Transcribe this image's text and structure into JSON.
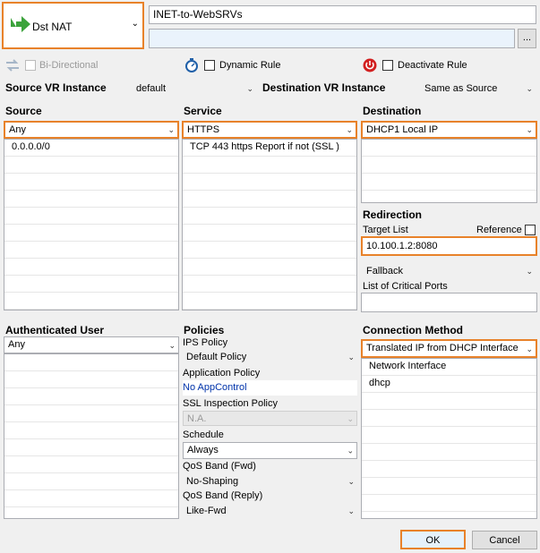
{
  "rule": {
    "action_label": "Dst NAT",
    "name": "INET-to-WebSRVs",
    "comment": "",
    "more_button": "..."
  },
  "options": {
    "bidirectional": "Bi-Directional",
    "dynamic_rule": "Dynamic Rule",
    "deactivate_rule": "Deactivate Rule"
  },
  "vr": {
    "source_label": "Source VR Instance",
    "source_value": "default",
    "dest_label": "Destination VR Instance",
    "dest_value": "Same as Source"
  },
  "source": {
    "label": "Source",
    "value": "Any",
    "items": [
      "0.0.0.0/0"
    ]
  },
  "service": {
    "label": "Service",
    "value": "HTTPS",
    "items": [
      "TCP  443 https  Report if not (SSL )"
    ]
  },
  "destination": {
    "label": "Destination",
    "value": "DHCP1 Local IP"
  },
  "redirection": {
    "label": "Redirection",
    "target_list_label": "Target List",
    "reference_label": "Reference",
    "target_value": "10.100.1.2:8080",
    "fallback_value": "Fallback",
    "critical_ports_label": "List of Critical Ports",
    "critical_ports_value": ""
  },
  "auth_user": {
    "label": "Authenticated User",
    "value": "Any"
  },
  "policies": {
    "label": "Policies",
    "ips_label": "IPS Policy",
    "ips_value": "Default Policy",
    "app_label": "Application Policy",
    "app_value": "No AppControl",
    "ssl_label": "SSL Inspection Policy",
    "ssl_value": "N.A.",
    "schedule_label": "Schedule",
    "schedule_value": "Always",
    "qos_fwd_label": "QoS Band (Fwd)",
    "qos_fwd_value": "No-Shaping",
    "qos_reply_label": "QoS Band (Reply)",
    "qos_reply_value": "Like-Fwd"
  },
  "connection": {
    "label": "Connection Method",
    "value": "Translated IP from DHCP Interface",
    "items": [
      "Network Interface",
      "dhcp"
    ]
  },
  "buttons": {
    "ok": "OK",
    "cancel": "Cancel"
  },
  "colors": {
    "highlight": "#e8822a",
    "arrow_green": "#3ca33c",
    "link_blue": "#0033aa",
    "deactivate_red": "#d21f1f"
  }
}
